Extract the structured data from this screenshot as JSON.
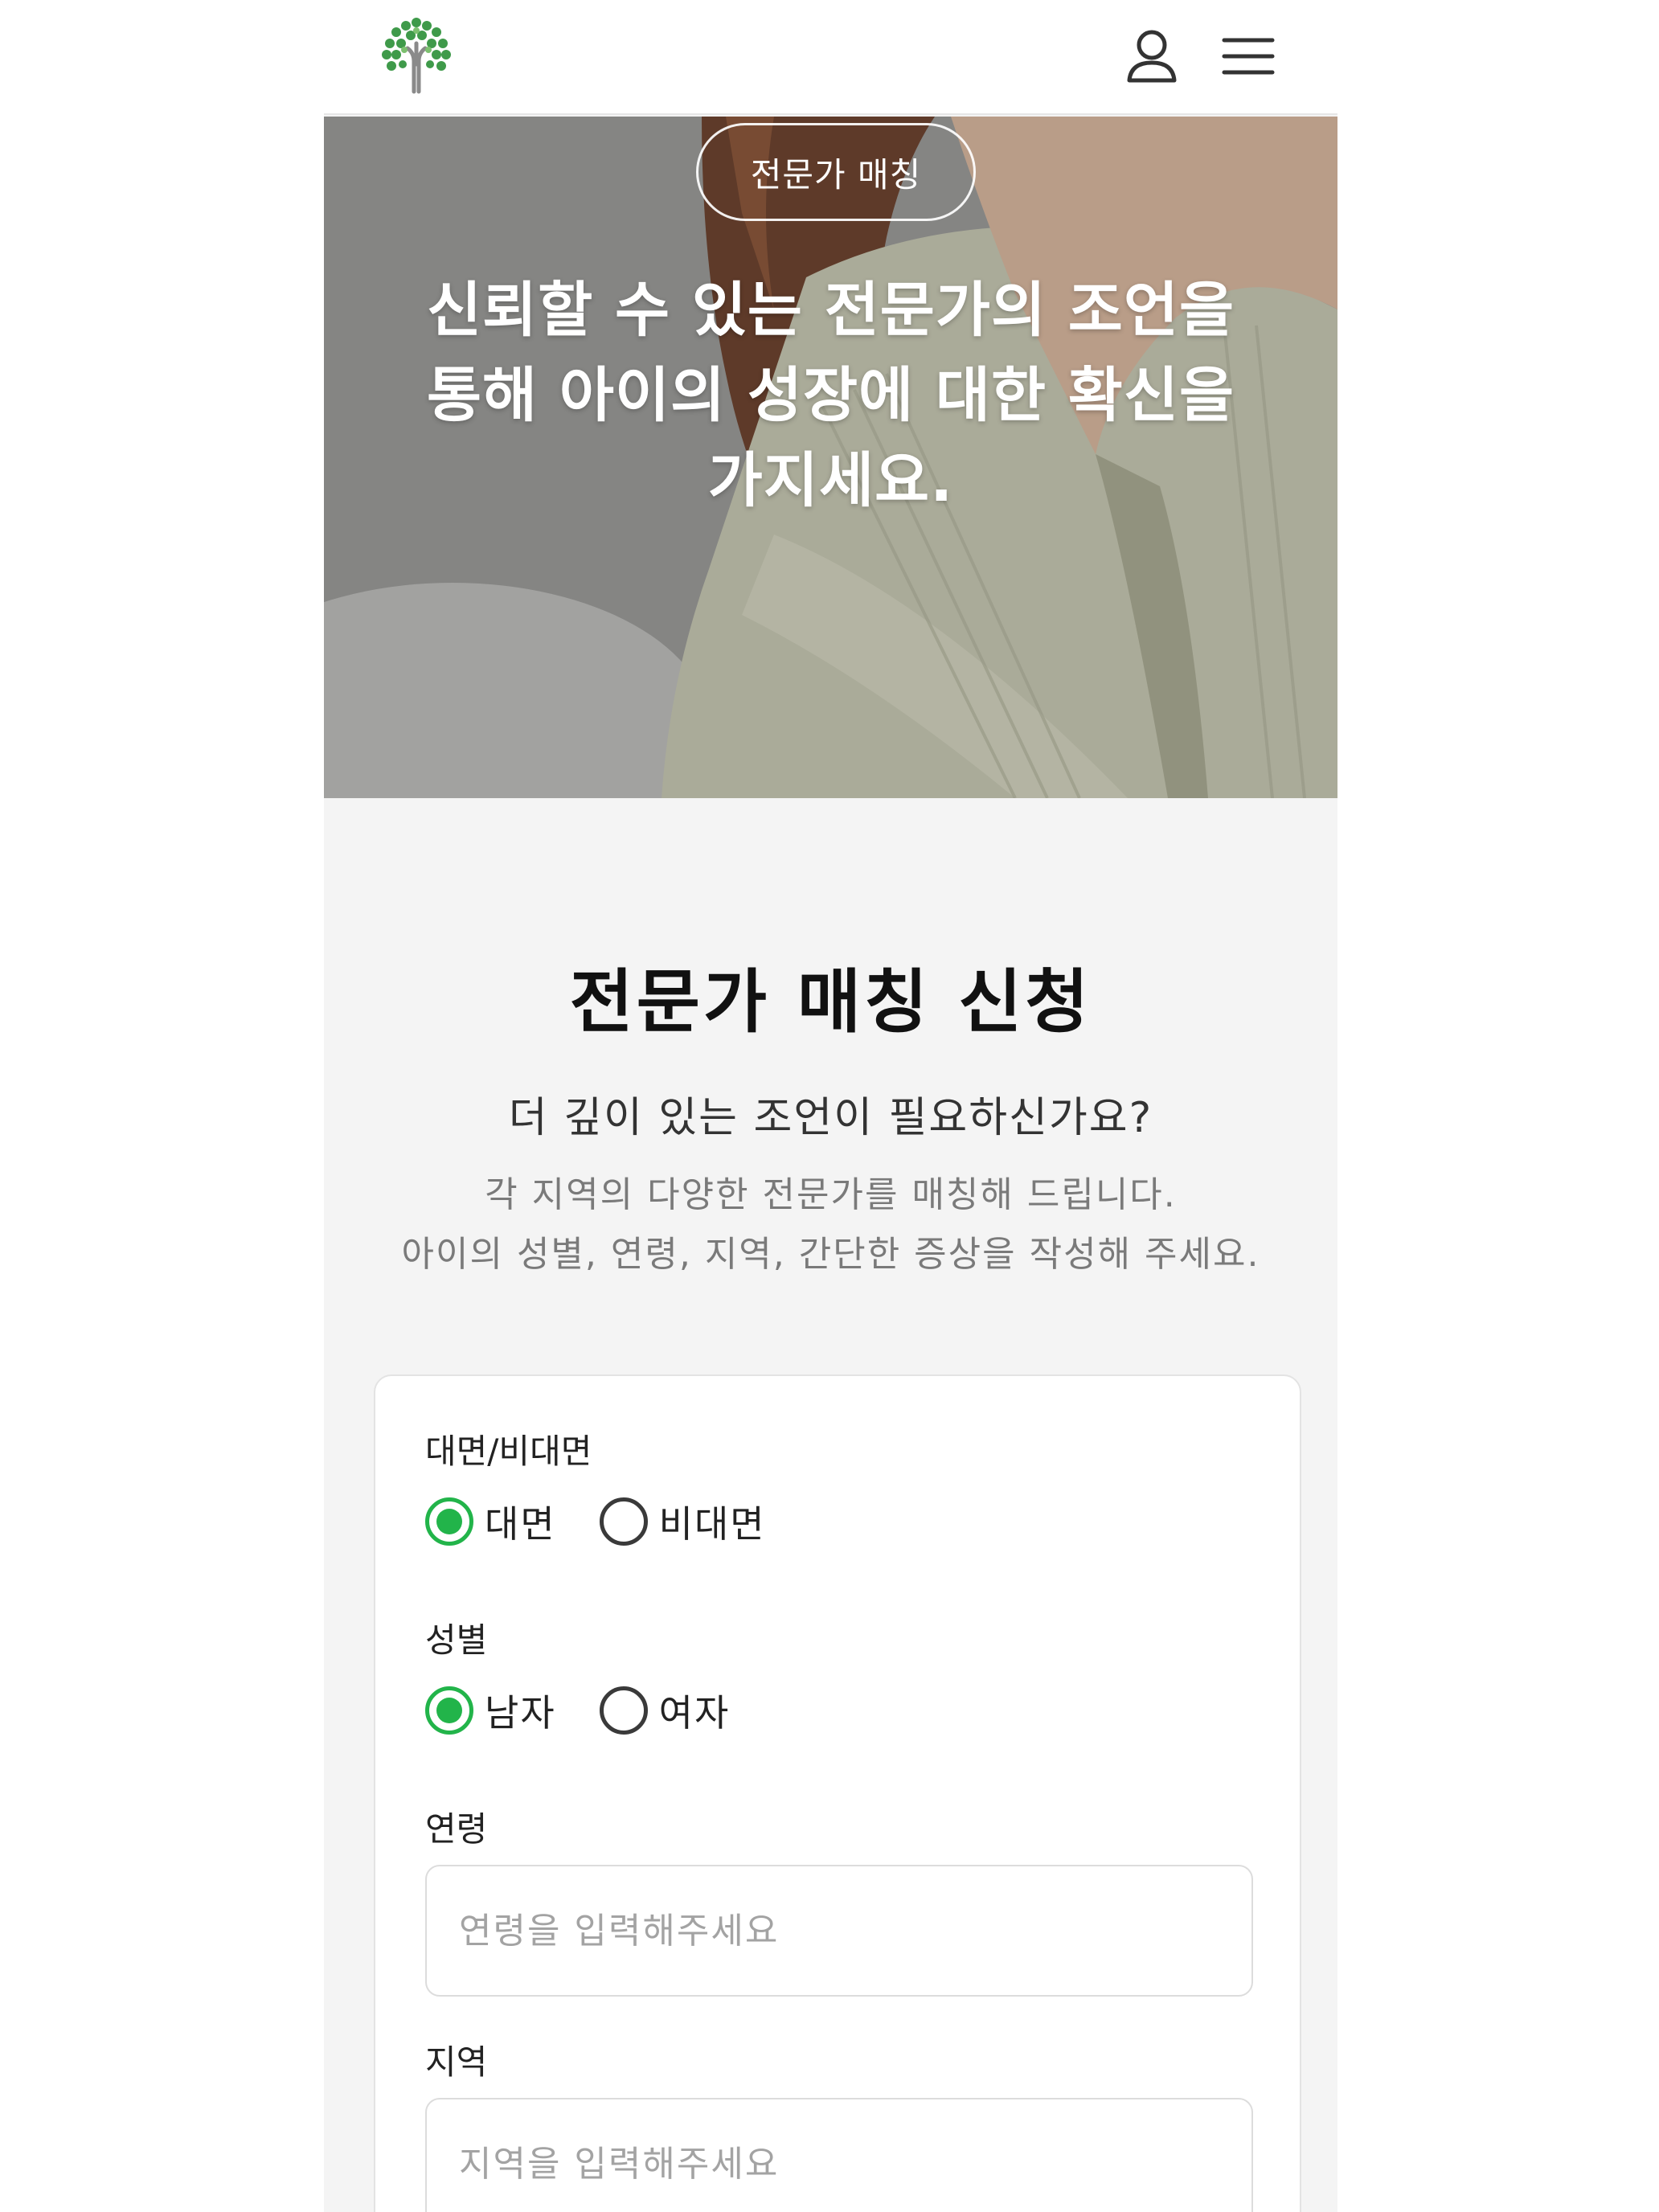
{
  "header": {
    "logo_icon": "tree-logo-icon",
    "user_icon": "user-icon",
    "menu_icon": "hamburger-menu-icon"
  },
  "hero": {
    "badge": "전문가 매칭",
    "title_lines": [
      "신뢰할 수 있는 전문가의 조언을",
      "통해 아이의 성장에 대한 확신을",
      "가지세요."
    ]
  },
  "intro": {
    "title": "전문가 매칭 신청",
    "subtitle": "더 깊이 있는 조언이 필요하신가요?",
    "description_lines": [
      "각 지역의 다양한 전문가를 매칭해 드립니다.",
      "아이의 성별, 연령, 지역, 간단한 증상을 작성해 주세요."
    ]
  },
  "form": {
    "meeting_type": {
      "label": "대면/비대면",
      "options": [
        "대면",
        "비대면"
      ],
      "selected": "대면"
    },
    "gender": {
      "label": "성별",
      "options": [
        "남자",
        "여자"
      ],
      "selected": "남자"
    },
    "age": {
      "label": "연령",
      "value": "",
      "placeholder": "연령을 입력해주세요"
    },
    "region": {
      "label": "지역",
      "value": "",
      "placeholder": "지역을 입력해주세요"
    }
  },
  "colors": {
    "accent_green": "#22b44a",
    "background": "#f4f4f4"
  }
}
